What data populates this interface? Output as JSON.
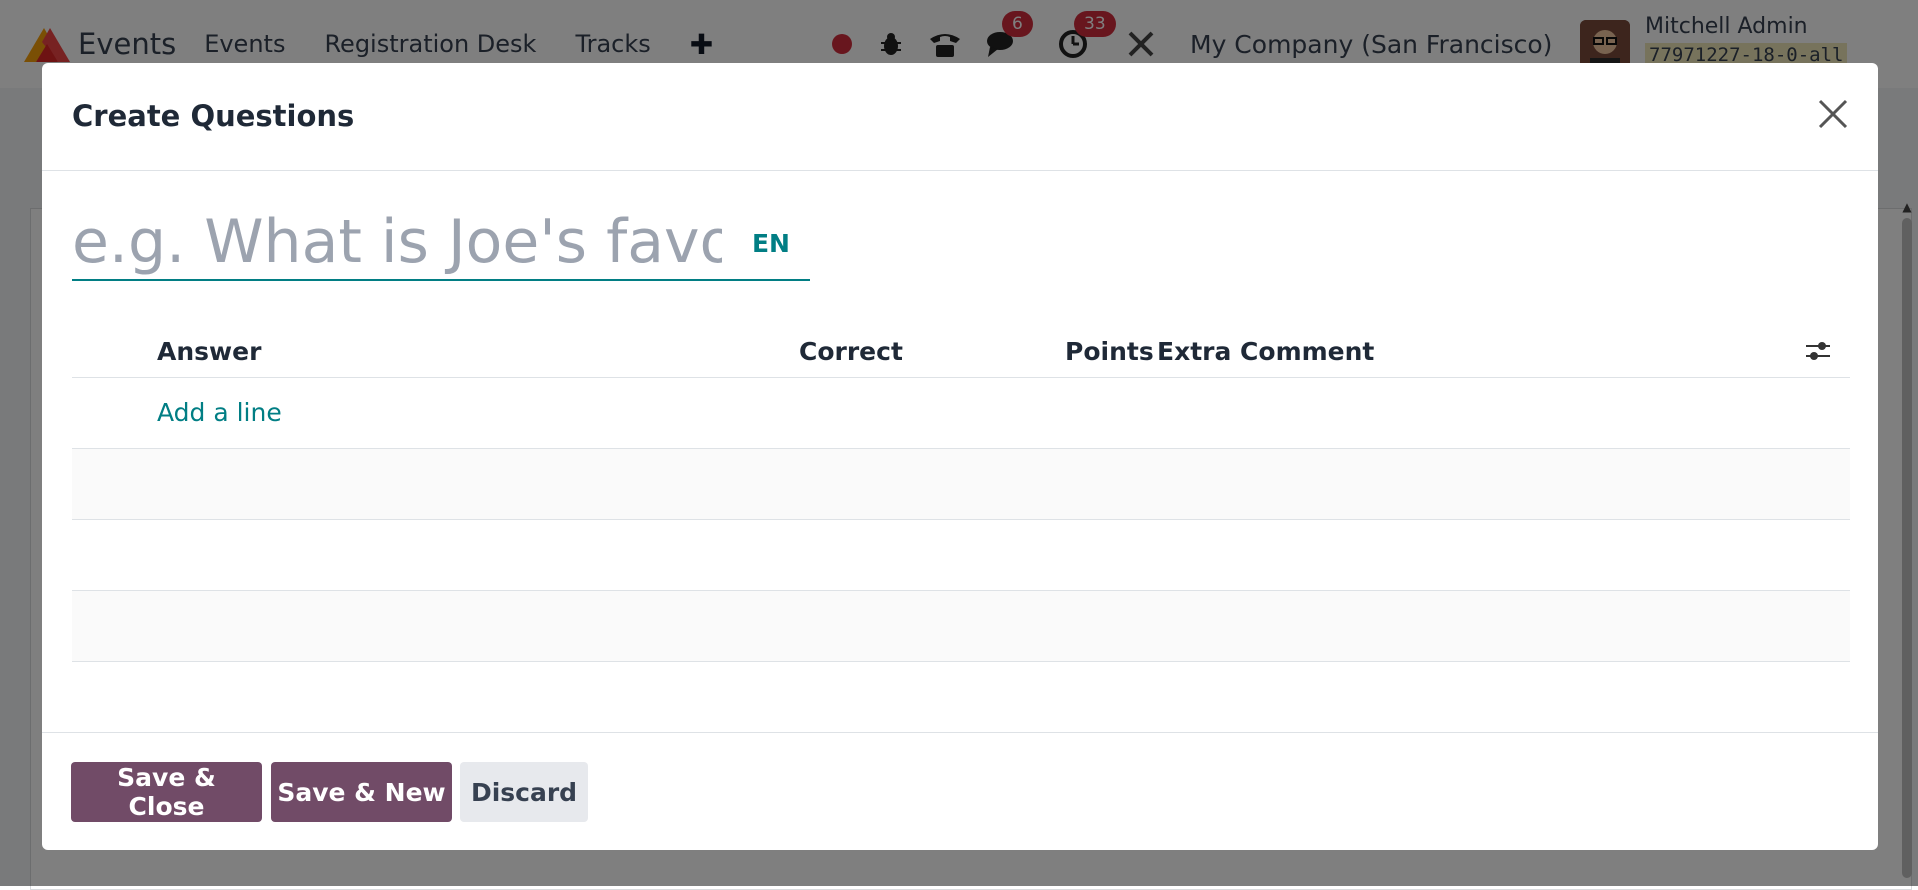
{
  "navbar": {
    "app_name": "Events",
    "menu": [
      "Events",
      "Registration Desk",
      "Tracks"
    ],
    "plus_label": "✚",
    "messages_count": "6",
    "activities_count": "33",
    "company": "My Company (San Francisco)",
    "user_name": "Mitchell Admin",
    "database": "77971227-18-0-all"
  },
  "modal": {
    "title": "Create Questions",
    "name_placeholder": "e.g. What is Joe's favorite",
    "name_value": "",
    "lang_label": "EN",
    "table": {
      "columns": [
        "Answer",
        "Correct",
        "Points",
        "Extra Comment"
      ],
      "add_line_label": "Add a line",
      "rows": []
    },
    "footer": {
      "save_close_label": "Save & Close",
      "save_new_label": "Save & New",
      "discard_label": "Discard"
    }
  },
  "colors": {
    "primary": "#714b67",
    "accent": "#017e84",
    "badge": "#d12c3c"
  }
}
